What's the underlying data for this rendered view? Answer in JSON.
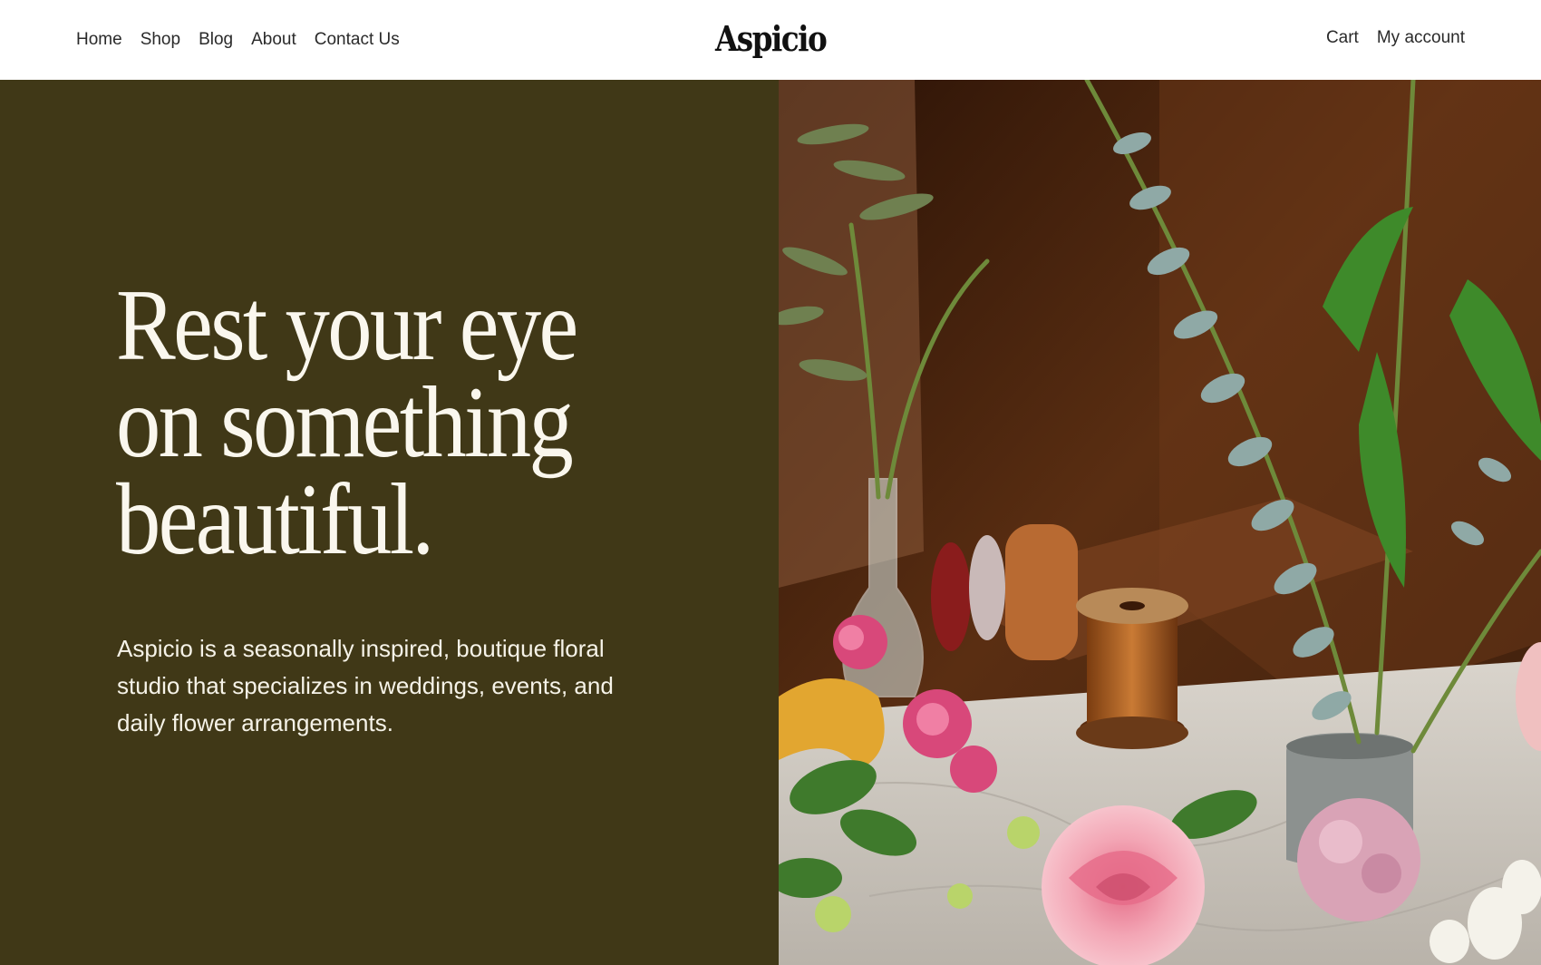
{
  "header": {
    "nav_left": [
      {
        "label": "Home"
      },
      {
        "label": "Shop"
      },
      {
        "label": "Blog"
      },
      {
        "label": "About"
      },
      {
        "label": "Contact Us"
      }
    ],
    "logo": "Aspicio",
    "nav_right": [
      {
        "label": "Cart"
      },
      {
        "label": "My account"
      }
    ]
  },
  "hero": {
    "headline": "Rest your eye on something beautiful.",
    "intro": "Aspicio is a seasonally inspired, boutique floral studio that specializes in weddings, events, and daily flower arrangements.",
    "colors": {
      "panel": "#403817",
      "text": "#faf7ee"
    }
  }
}
